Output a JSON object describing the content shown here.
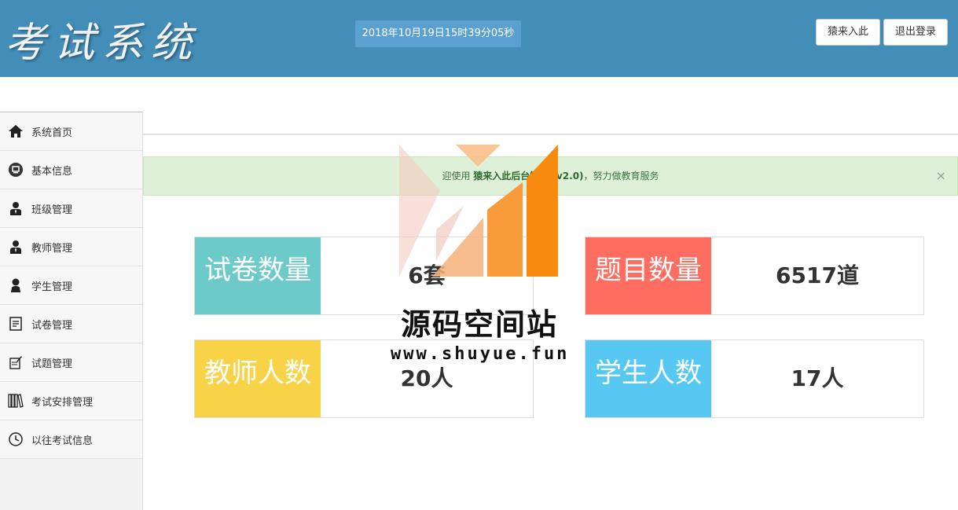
{
  "header": {
    "logo": "考试系统",
    "clock": "2018年10月19日15时39分05秒",
    "btn_home": "猿来入此",
    "btn_logout": "退出登录"
  },
  "sidebar": {
    "items": [
      {
        "label": "系统首页",
        "icon": "home-icon"
      },
      {
        "label": "基本信息",
        "icon": "monitor-icon"
      },
      {
        "label": "班级管理",
        "icon": "user-tie-icon"
      },
      {
        "label": "教师管理",
        "icon": "user-tie-icon"
      },
      {
        "label": "学生管理",
        "icon": "user-icon"
      },
      {
        "label": "试卷管理",
        "icon": "document-icon"
      },
      {
        "label": "试题管理",
        "icon": "edit-document-icon"
      },
      {
        "label": "考试安排管理",
        "icon": "books-icon"
      },
      {
        "label": "以往考试信息",
        "icon": "clock-icon"
      }
    ]
  },
  "alert": {
    "prefix": "迎使用",
    "app_name": "猿来入此后台管",
    "suffix_bold": "统 (v2.0)",
    "suffix": "，努力做教育服务",
    "close": "×"
  },
  "stats": [
    {
      "label": "试卷数量",
      "value": "6套",
      "color": "#6ccac9"
    },
    {
      "label": "题目数量",
      "value": "6517道",
      "color": "#ff6c60"
    },
    {
      "label": "教师人数",
      "value": "20人",
      "color": "#f8d347"
    },
    {
      "label": "学生人数",
      "value": "17人",
      "color": "#57c8f2"
    }
  ],
  "watermark": {
    "title": "源码空间站",
    "url": "www.shuyue.fun"
  }
}
